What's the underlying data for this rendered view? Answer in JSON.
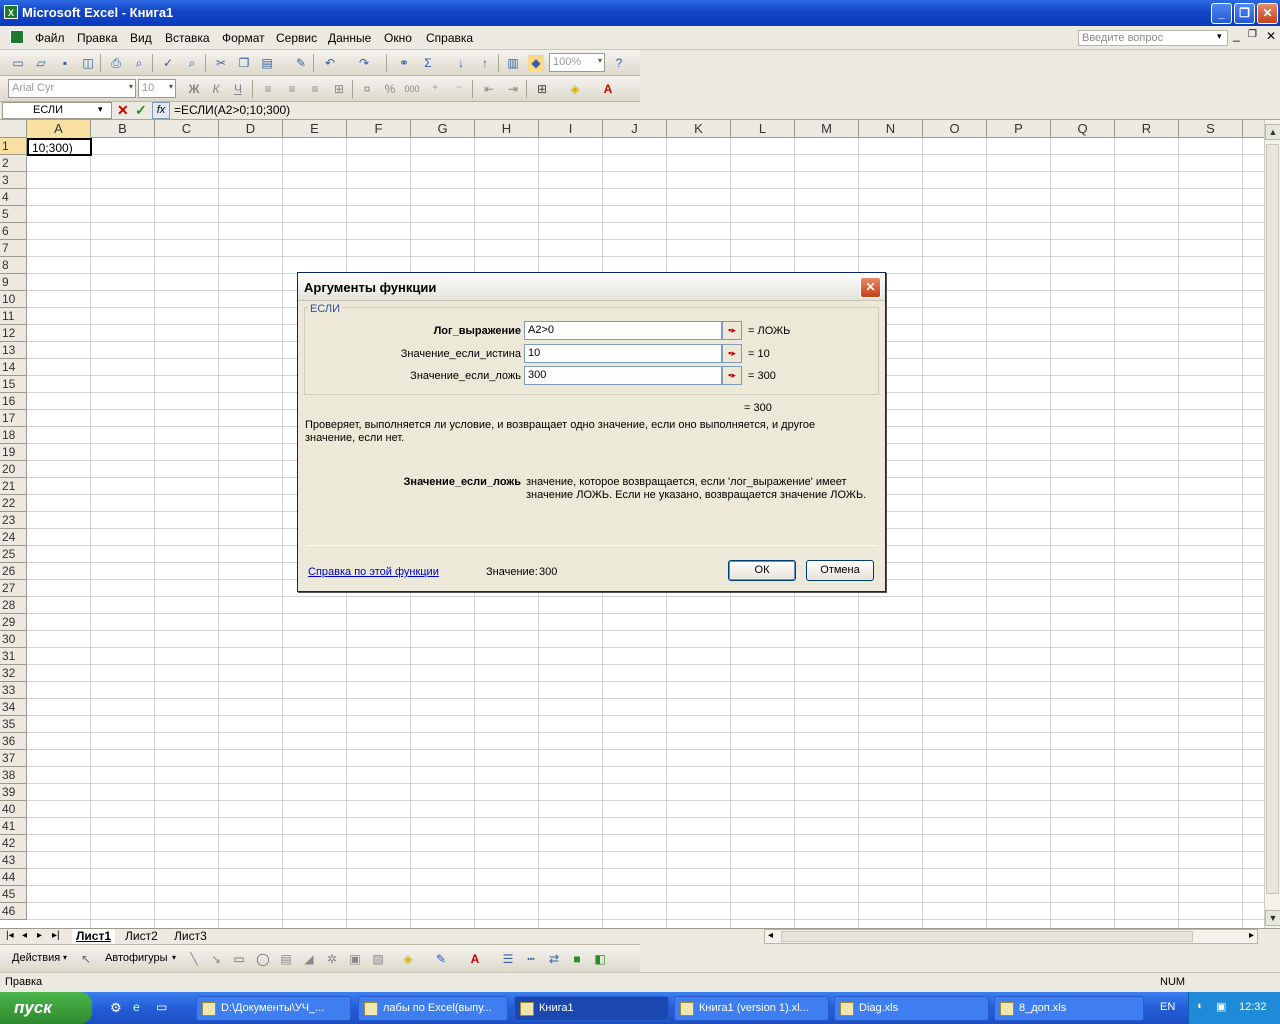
{
  "window": {
    "title": "Microsoft Excel - Книга1",
    "app_icon": "X",
    "min": "_",
    "max": "❐",
    "close": "✕"
  },
  "menu": {
    "items": [
      "Файл",
      "Правка",
      "Вид",
      "Вставка",
      "Формат",
      "Сервис",
      "Данные",
      "Окно",
      "Справка"
    ],
    "ask_placeholder": "Введите вопрос"
  },
  "toolbar": {
    "zoom": "100%",
    "font": "Arial Cyr",
    "size": "10",
    "bold": "Ж",
    "italic": "К",
    "underline": "Ч",
    "percent": "%",
    "thousands": "000"
  },
  "formula_bar": {
    "name_box": "ЕСЛИ",
    "fx": "fx",
    "formula": "=ЕСЛИ(A2>0;10;300)"
  },
  "sheet": {
    "columns": [
      "A",
      "B",
      "C",
      "D",
      "E",
      "F",
      "G",
      "H",
      "I",
      "J",
      "K",
      "L",
      "M",
      "N",
      "O",
      "P",
      "Q",
      "R",
      "S"
    ],
    "rows": [
      "1",
      "2",
      "3",
      "4",
      "5",
      "6",
      "7",
      "8",
      "9",
      "10",
      "11",
      "12",
      "13",
      "14",
      "15",
      "16",
      "17",
      "18",
      "19",
      "20",
      "21",
      "22",
      "23",
      "24",
      "25",
      "26",
      "27",
      "28",
      "29",
      "30",
      "31",
      "32",
      "33",
      "34",
      "35",
      "36",
      "37",
      "38",
      "39",
      "40",
      "41",
      "42",
      "43",
      "44",
      "45",
      "46"
    ],
    "active_cell_text": "10;300)",
    "tabs": [
      "Лист1",
      "Лист2",
      "Лист3"
    ]
  },
  "dialog": {
    "title": "Аргументы функции",
    "group": "ЕСЛИ",
    "args": [
      {
        "label": "Лог_выражение",
        "value": "A2>0",
        "result": "= ЛОЖЬ"
      },
      {
        "label": "Значение_если_истина",
        "value": "10",
        "result": "= 10"
      },
      {
        "label": "Значение_если_ложь",
        "value": "300",
        "result": "= 300"
      }
    ],
    "total": "= 300",
    "description": "Проверяет, выполняется ли условие, и возвращает одно значение, если оно выполняется, и другое значение, если нет.",
    "param_name": "Значение_если_ложь",
    "param_desc": "значение, которое возвращается, если 'лог_выражение' имеет значение ЛОЖЬ. Если не указано, возвращается значение ЛОЖЬ.",
    "help_link": "Справка по этой функции",
    "value_label": "Значение:",
    "value": "300",
    "ok": "ОК",
    "cancel": "Отмена"
  },
  "drawing": {
    "actions": "Действия",
    "autoshapes": "Автофигуры"
  },
  "status": {
    "left": "Правка",
    "num": "NUM"
  },
  "taskbar": {
    "start": "пуск",
    "items": [
      "D:\\Документы\\УЧ_...",
      "лабы по Excel(выпу...",
      "Книга1",
      "Книга1 (version 1).xl...",
      "Diag.xls",
      "8_доп.xls"
    ],
    "lang": "EN",
    "clock": "12:32"
  }
}
